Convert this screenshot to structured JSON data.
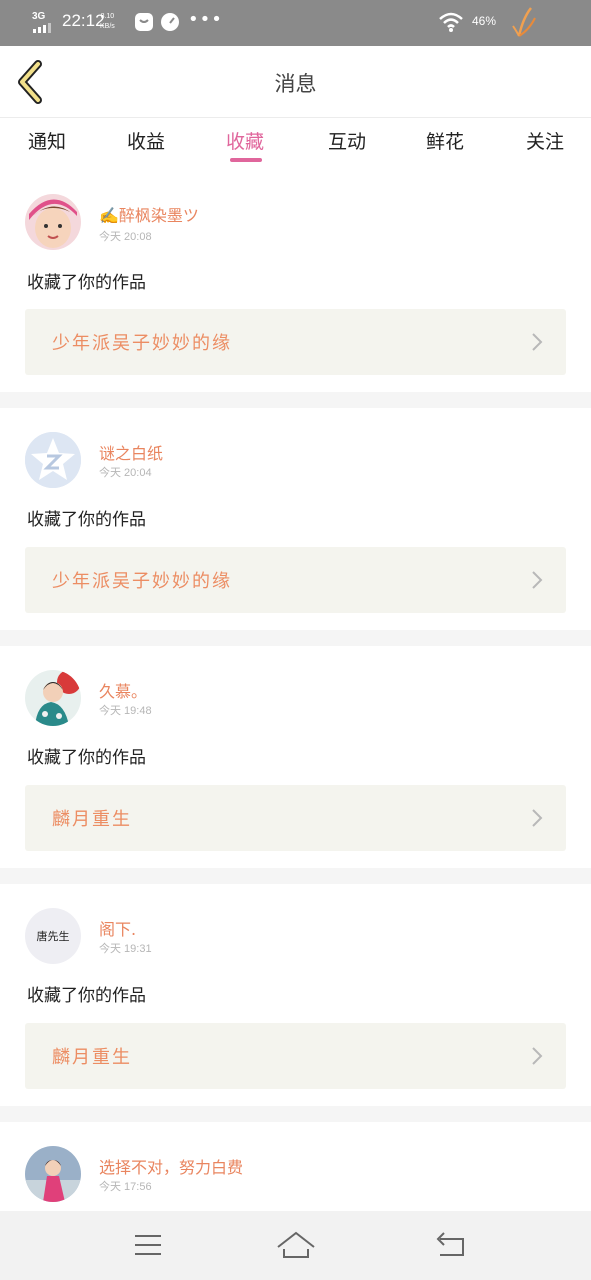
{
  "status_bar": {
    "network": "3G",
    "time": "22:12",
    "speed_value": "8.10",
    "speed_unit": "KB/s",
    "dots": "•••",
    "battery": "46%"
  },
  "header": {
    "title": "消息"
  },
  "tabs": [
    {
      "label": "通知"
    },
    {
      "label": "收益"
    },
    {
      "label": "收藏"
    },
    {
      "label": "互动"
    },
    {
      "label": "鲜花"
    },
    {
      "label": "关注"
    }
  ],
  "active_tab": "收藏",
  "notifications": [
    {
      "username": "✍醉枫染墨ツ",
      "time": "今天 20:08",
      "message": "收藏了你的作品",
      "work_title": "少年派吴子妙妙的缘"
    },
    {
      "username": "谜之白纸",
      "time": "今天 20:04",
      "message": "收藏了你的作品",
      "work_title": "少年派吴子妙妙的缘"
    },
    {
      "username": "久慕。",
      "time": "今天 19:48",
      "message": "收藏了你的作品",
      "work_title": "麟月重生"
    },
    {
      "username": "阁下.",
      "time": "今天 19:31",
      "message": "收藏了你的作品",
      "work_title": "麟月重生",
      "avatar_text": "唐先生"
    },
    {
      "username": "选择不对，努力白费",
      "time": "今天 17:56"
    }
  ],
  "colors": {
    "accent": "#e0669c",
    "username": "#e9855f",
    "work_title": "#ec8d63",
    "work_box_bg": "#f4f4ee",
    "status_bar_bg": "#8a8a8a"
  },
  "icons": {
    "back": "chevron-left-icon",
    "work_arrow": "chevron-right-icon",
    "nav_menu": "menu-icon",
    "nav_home": "home-icon",
    "nav_back": "return-icon"
  }
}
